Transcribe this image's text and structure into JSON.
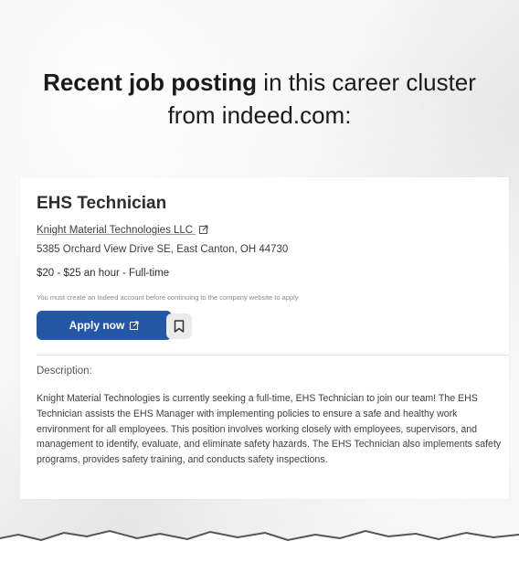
{
  "heading": {
    "bold": "Recent job posting",
    "rest": " in this career cluster from indeed.com:"
  },
  "job": {
    "title": "EHS Technician",
    "company": "Knight Material Technologies LLC",
    "address": "5385 Orchard View Drive SE, East Canton, OH 44730",
    "salary": "$20 - $25 an hour  - Full-time",
    "notice": "You must create an Indeed account before continuing to the company website to apply",
    "apply_label": "Apply now",
    "description_label": "Description:",
    "description": "Knight Material Technologies is currently seeking a full-time, EHS Technician to join our team! The EHS Technician assists the EHS Manager with implementing policies to ensure a safe and healthy work environment for all employees. This position involves working closely with employees, supervisors, and management to identify, evaluate, and eliminate safety hazards. The EHS Technician also implements safety programs, provides safety training, and conducts safety inspections."
  },
  "colors": {
    "apply_button": "#2557a7",
    "save_button_bg": "#ebebeb",
    "page_bg": "#eeeeee"
  },
  "icons": {
    "company_link": "external-link-icon",
    "apply": "external-link-icon",
    "save": "bookmark-icon"
  }
}
